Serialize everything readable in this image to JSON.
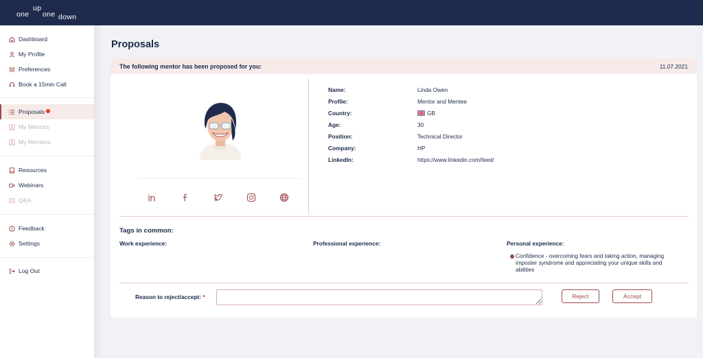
{
  "logo": {
    "w1": "one",
    "w2": "up",
    "w3": "one",
    "w4": "down"
  },
  "sidebar": {
    "items": [
      {
        "label": "Dashboard",
        "icon": "home-icon"
      },
      {
        "label": "My Profile",
        "icon": "user-icon"
      },
      {
        "label": "Preferences",
        "icon": "sliders-icon"
      },
      {
        "label": "Book a 15min Call",
        "icon": "headset-icon"
      },
      {
        "label": "Proposals",
        "icon": "list-icon",
        "active": true,
        "notification": true
      },
      {
        "label": "My Mentors",
        "icon": "people-icon",
        "disabled": true
      },
      {
        "label": "My Mentees",
        "icon": "people-icon",
        "disabled": true
      },
      {
        "label": "Resources",
        "icon": "book-icon"
      },
      {
        "label": "Webinars",
        "icon": "video-icon"
      },
      {
        "label": "Q&A",
        "icon": "qa-icon",
        "disabled": true
      },
      {
        "label": "Feedback",
        "icon": "feedback-icon"
      },
      {
        "label": "Settings",
        "icon": "gear-icon"
      },
      {
        "label": "Log Out",
        "icon": "logout-icon"
      }
    ]
  },
  "page": {
    "title": "Proposals",
    "banner": "The following mentor has been proposed for you:",
    "date": "11.07.2021"
  },
  "profile": {
    "labels": {
      "name": "Name:",
      "profile": "Profile:",
      "country": "Country:",
      "age": "Age:",
      "position": "Position:",
      "company": "Company:",
      "linkedin": "LinkedIn:"
    },
    "values": {
      "name": "Linda Owen",
      "profile": "Mentor and Mentee",
      "country": "GB",
      "age": "30",
      "position": "Technical Director",
      "company": "HP",
      "linkedin": "https://www.linkedin.com/feed/"
    },
    "social": [
      "linkedin-icon",
      "facebook-icon",
      "twitter-icon",
      "instagram-icon",
      "globe-icon"
    ]
  },
  "tags": {
    "title": "Tags in common:",
    "work": "Work experience:",
    "professional": "Professional experience:",
    "personal": "Personal experience:",
    "personal_item": "Confidence - overcoming fears and taking action, managing imposter syndrome and appreciating your unique skills and abilities"
  },
  "reason": {
    "label": "Reason to reject/accept:",
    "required": "*",
    "value": ""
  },
  "buttons": {
    "reject": "Reject",
    "accept": "Accept"
  },
  "colors": {
    "topbar": "#1e2b4d",
    "accent": "#9e4a4a",
    "highlight": "#f6ebe9",
    "notification": "#e53b2c"
  }
}
